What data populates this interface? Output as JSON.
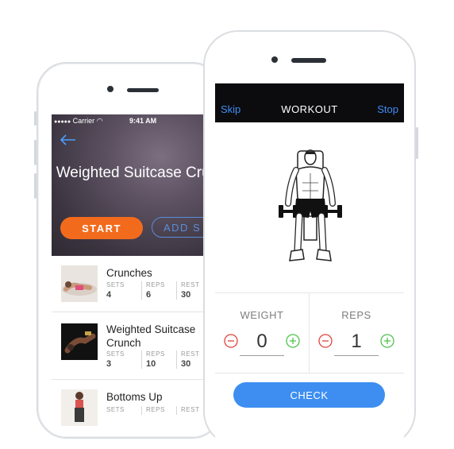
{
  "back_phone": {
    "statusbar": {
      "dots": "●●●●●",
      "carrier": "Carrier",
      "time": "9:41 AM"
    },
    "exercise_title": "Weighted Suitcase Crunch",
    "buttons": {
      "start": "START",
      "add": "ADD S"
    },
    "exercises": [
      {
        "name": "Crunches",
        "sets_label": "SETS",
        "sets": "4",
        "reps_label": "REPS",
        "reps": "6",
        "rest_label": "REST",
        "rest": "30"
      },
      {
        "name": "Weighted Suitcase Crunch",
        "sets_label": "SETS",
        "sets": "3",
        "reps_label": "REPS",
        "reps": "10",
        "rest_label": "REST",
        "rest": "30"
      },
      {
        "name": "Bottoms Up",
        "sets_label": "SETS",
        "sets": "",
        "reps_label": "REPS",
        "reps": "",
        "rest_label": "REST",
        "rest": ""
      }
    ]
  },
  "front_phone": {
    "topbar": {
      "skip": "Skip",
      "title": "WORKOUT",
      "stop": "Stop"
    },
    "weight": {
      "label": "WEIGHT",
      "value": "0"
    },
    "reps": {
      "label": "REPS",
      "value": "1"
    },
    "check_button": "CHECK"
  },
  "colors": {
    "orange": "#f26b1d",
    "blue": "#3d8ef0",
    "stepper_minus": "#e2423c",
    "stepper_plus": "#4cc24a",
    "topbar": "#0c0c0e"
  },
  "icons": {
    "back": "back-arrow-icon",
    "minus": "minus-circle-icon",
    "plus": "plus-circle-icon"
  }
}
